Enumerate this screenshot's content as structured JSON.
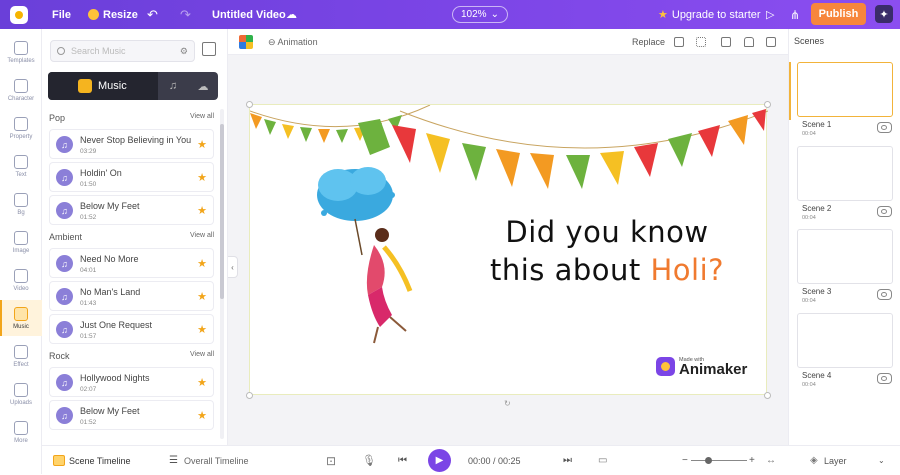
{
  "topbar": {
    "file": "File",
    "resize": "Resize",
    "undo_icon": "↶",
    "redo_icon": "↷",
    "title": "Untitled Video",
    "cloud_icon": "☁",
    "zoom": "102%",
    "zoom_caret": "⌄",
    "upgrade": "Upgrade to starter",
    "upgrade_icon": "★",
    "play_icon": "▷",
    "share_icon": "⋔",
    "publish": "Publish",
    "avatar_glyph": "✦",
    "colors": {
      "bar": "#7b45e6",
      "publish": "#f7863c"
    }
  },
  "leftnav": [
    {
      "label": "Templates",
      "icon": "templates-icon"
    },
    {
      "label": "Character",
      "icon": "character-icon"
    },
    {
      "label": "Property",
      "icon": "property-icon"
    },
    {
      "label": "Text",
      "icon": "text-icon"
    },
    {
      "label": "Bg",
      "icon": "bg-icon"
    },
    {
      "label": "Image",
      "icon": "image-icon"
    },
    {
      "label": "Video",
      "icon": "video-icon"
    },
    {
      "label": "Music",
      "icon": "music-icon",
      "active": true
    },
    {
      "label": "Effect",
      "icon": "effect-icon"
    },
    {
      "label": "Uploads",
      "icon": "uploads-icon"
    },
    {
      "label": "More",
      "icon": "more-icon"
    }
  ],
  "panel": {
    "search_placeholder": "Search Music",
    "filter_icon": "⚙",
    "tab_music": "Music",
    "tab_sfx_icon": "♫",
    "tab_upload_icon": "☁",
    "scroll_left": "‹",
    "sections": [
      {
        "title": "Pop",
        "view_all": "View all",
        "tracks": [
          {
            "name": "Never Stop Believing in You",
            "duration": "03:29"
          },
          {
            "name": "Holdin' On",
            "duration": "01:50"
          },
          {
            "name": "Below My Feet",
            "duration": "01:52"
          }
        ]
      },
      {
        "title": "Ambient",
        "view_all": "View all",
        "tracks": [
          {
            "name": "Need No More",
            "duration": "04:01"
          },
          {
            "name": "No Man's Land",
            "duration": "01:43"
          },
          {
            "name": "Just One Request",
            "duration": "01:57"
          }
        ]
      },
      {
        "title": "Rock",
        "view_all": "View all",
        "tracks": [
          {
            "name": "Hollywood Nights",
            "duration": "02:07"
          },
          {
            "name": "Below My Feet",
            "duration": "01:52"
          }
        ]
      }
    ]
  },
  "canvas": {
    "animation": "Animation",
    "replace": "Replace",
    "question_line1": "Did you know",
    "question_line2_prefix": "this about ",
    "question_highlight": "Holi?",
    "made_with": "Made with",
    "brand": "Animaker",
    "rotate_icon": "↻",
    "colors": {
      "highlight": "#f07a2f"
    }
  },
  "scenes": {
    "title": "Scenes",
    "items": [
      {
        "label": "Scene 1",
        "duration": "00:04"
      },
      {
        "label": "Scene 2",
        "duration": "00:04"
      },
      {
        "label": "Scene 3",
        "duration": "00:04"
      },
      {
        "label": "Scene 4",
        "duration": "00:04"
      }
    ]
  },
  "bottombar": {
    "scene_timeline": "Scene Timeline",
    "overall_timeline": "Overall Timeline",
    "overall_icon": "☰",
    "fit_icon": "⊡",
    "mic_icon": "🎙",
    "prev_icon": "⏮",
    "play_icon": "▶",
    "time": "00:00 / 00:25",
    "next_icon": "⏭",
    "subtitle_icon": "▭",
    "zoom_minus": "−",
    "zoom_plus": "+",
    "fit_width_icon": "↔",
    "layer_icon": "◈",
    "layer": "Layer",
    "chevron": "⌄"
  }
}
